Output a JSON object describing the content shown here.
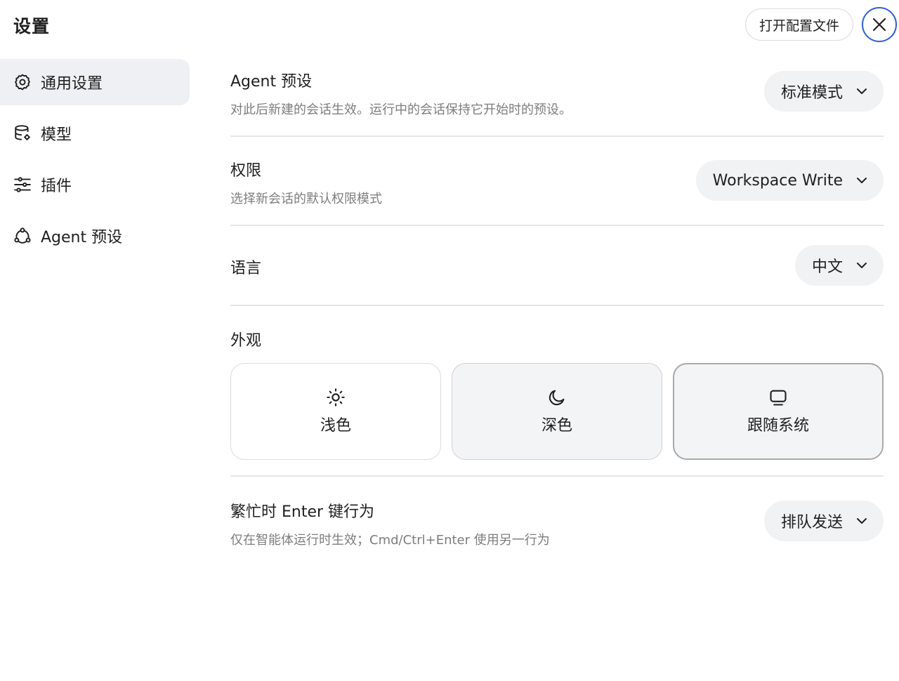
{
  "header": {
    "title": "设置",
    "open_config_label": "打开配置文件"
  },
  "sidebar": {
    "items": [
      {
        "label": "通用设置",
        "icon": "gear-icon",
        "active": true
      },
      {
        "label": "模型",
        "icon": "database-icon",
        "active": false
      },
      {
        "label": "插件",
        "icon": "sliders-icon",
        "active": false
      },
      {
        "label": "Agent 预设",
        "icon": "agent-icon",
        "active": false
      }
    ]
  },
  "settings": {
    "agent_preset": {
      "title": "Agent 预设",
      "description": "对此后新建的会话生效。运行中的会话保持它开始时的预设。",
      "value": "标准模式"
    },
    "permissions": {
      "title": "权限",
      "description": "选择新会话的默认权限模式",
      "value": "Workspace Write"
    },
    "language": {
      "title": "语言",
      "value": "中文"
    },
    "appearance": {
      "title": "外观",
      "options": [
        {
          "label": "浅色",
          "icon": "sun-icon"
        },
        {
          "label": "深色",
          "icon": "moon-icon"
        },
        {
          "label": "跟随系统",
          "icon": "monitor-icon"
        }
      ],
      "selected": "跟随系统"
    },
    "busy_enter": {
      "title": "繁忙时 Enter 键行为",
      "description": "仅在智能体运行时生效；Cmd/Ctrl+Enter 使用另一行为",
      "value": "排队发送"
    }
  },
  "colors": {
    "accent": "#2f5fd0",
    "active_bg": "#eef0f3",
    "muted_text": "#7d7d7d"
  }
}
